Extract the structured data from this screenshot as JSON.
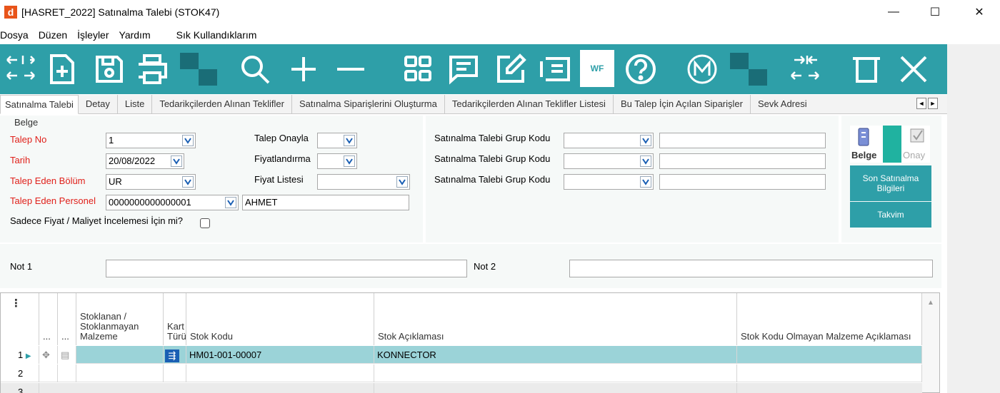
{
  "window": {
    "title": "[HASRET_2022] Satınalma Talebi (STOK47)",
    "app_icon": "d",
    "minimize": "—",
    "maximize": "☐",
    "close": "✕"
  },
  "menu": [
    "Dosya",
    "Düzen",
    "İşleyler",
    "Yardım",
    "Sık Kullandıklarım"
  ],
  "toolbar": {
    "accent": "#2e9fa8",
    "icons": [
      "expand-arrows-icon",
      "new-document-icon",
      "save-icon",
      "print-icon",
      "checker-icon",
      "search-icon",
      "add-icon",
      "remove-icon",
      "grid-icon",
      "comment-icon",
      "edit-icon",
      "list-icon",
      "workflow-icon",
      "help-icon",
      "m-icon",
      "checker-icon",
      "collapse-arrows-icon",
      "delete-icon",
      "close-icon"
    ],
    "wf_label": "WF"
  },
  "tabs": [
    "Satınalma Talebi",
    "Detay",
    "Liste",
    "Tedarikçilerden Alınan Teklifler",
    "Satınalma Siparişlerini Oluşturma",
    "Tedarikçilerden Alınan Teklifler Listesi",
    "Bu Talep İçin Açılan Siparişler",
    "Sevk Adresi"
  ],
  "tab_scroll": {
    "left": "◄",
    "right": "►"
  },
  "form": {
    "group_title": "Belge",
    "talep_no": {
      "label": "Talep No",
      "value": "1"
    },
    "tarih": {
      "label": "Tarih",
      "value": "20/08/2022"
    },
    "bolum": {
      "label": "Talep Eden Bölüm",
      "value": "UR"
    },
    "personel": {
      "label": "Talep Eden Personel",
      "value": "0000000000000001",
      "name": "AHMET"
    },
    "fiyat_check_label": "Sadece Fiyat / Maliyet İncelemesi İçin mi?",
    "onayla": {
      "label": "Talep Onayla",
      "value": ""
    },
    "fiyatlandirma": {
      "label": "Fiyatlandırma",
      "value": ""
    },
    "fiyat_listesi": {
      "label": "Fiyat Listesi",
      "value": ""
    },
    "grup_kodu": [
      {
        "label": "Satınalma Talebi Grup Kodu",
        "value": "",
        "desc": ""
      },
      {
        "label": "Satınalma Talebi Grup Kodu",
        "value": "",
        "desc": ""
      },
      {
        "label": "Satınalma Talebi Grup Kodu",
        "value": "",
        "desc": ""
      }
    ],
    "not1": {
      "label": "Not 1",
      "value": ""
    },
    "not2": {
      "label": "Not 2",
      "value": ""
    }
  },
  "side_buttons": {
    "belge": "Belge",
    "onay": "Onay",
    "son_satinalma": "Son Satınalma Bilgileri",
    "takvim": "Takvim"
  },
  "grid": {
    "menu_glyph": "⋮",
    "headers": {
      "dots1": "...",
      "dots2": "...",
      "stoklanan": "Stoklanan / Stoklanmayan Malzeme",
      "kart_turu": "Kart Türü",
      "stok_kodu": "Stok Kodu",
      "stok_aciklamasi": "Stok Açıklaması",
      "stok_kodu_olmayan": "Stok Kodu Olmayan Malzeme Açıklaması"
    },
    "rows": [
      {
        "num": "1",
        "stok_kodu": "HM01-001-00007",
        "aciklama": "KONNECTOR"
      },
      {
        "num": "2",
        "stok_kodu": "",
        "aciklama": ""
      },
      {
        "num": "3",
        "stok_kodu": "",
        "aciklama": ""
      }
    ]
  }
}
